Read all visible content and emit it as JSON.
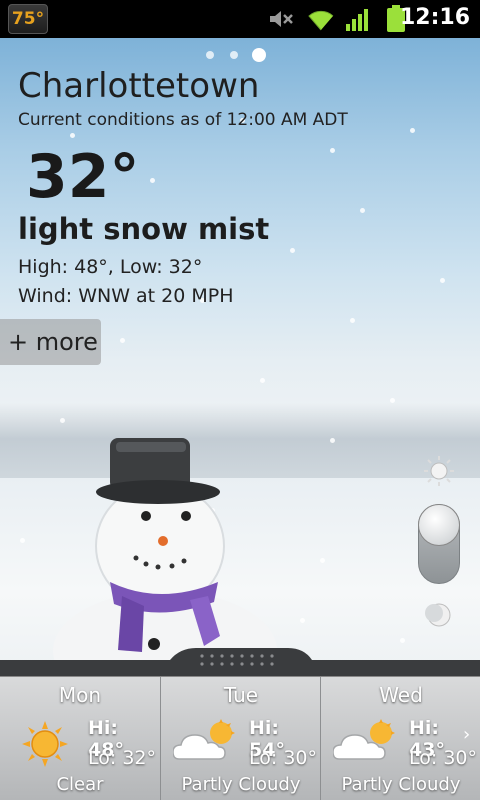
{
  "status_bar": {
    "temp_badge": "75°",
    "clock": "12:16",
    "icons": [
      "mute-icon",
      "wifi-icon",
      "signal-icon",
      "battery-icon"
    ]
  },
  "pager": {
    "pages": 3,
    "active": 3
  },
  "current": {
    "city": "Charlottetown",
    "as_of": "Current conditions as of  12:00 AM ADT",
    "temperature": "32°",
    "condition": "light snow mist",
    "high_low": "High: 48°, Low: 32°",
    "wind": "Wind: WNW at 20 MPH",
    "more_label": "+ more"
  },
  "brightness": {
    "icons": [
      "sun-icon",
      "moon-icon"
    ],
    "level": 1.0
  },
  "forecast": [
    {
      "day": "Mon",
      "hi": "Hi: 48°",
      "lo": "Lo: 32°",
      "desc": "Clear",
      "icon": "sun-icon"
    },
    {
      "day": "Tue",
      "hi": "Hi: 54°",
      "lo": "Lo: 30°",
      "desc": "Partly Cloudy",
      "icon": "partly-cloudy-icon"
    },
    {
      "day": "Wed",
      "hi": "Hi: 43°",
      "lo": "Lo: 30°",
      "desc": "Partly Cloudy",
      "icon": "partly-cloudy-icon"
    }
  ],
  "colors": {
    "badge_text": "#e6a11e",
    "battery": "#9be03a",
    "wifi": "#9be03a",
    "sun": "#f5a623"
  }
}
